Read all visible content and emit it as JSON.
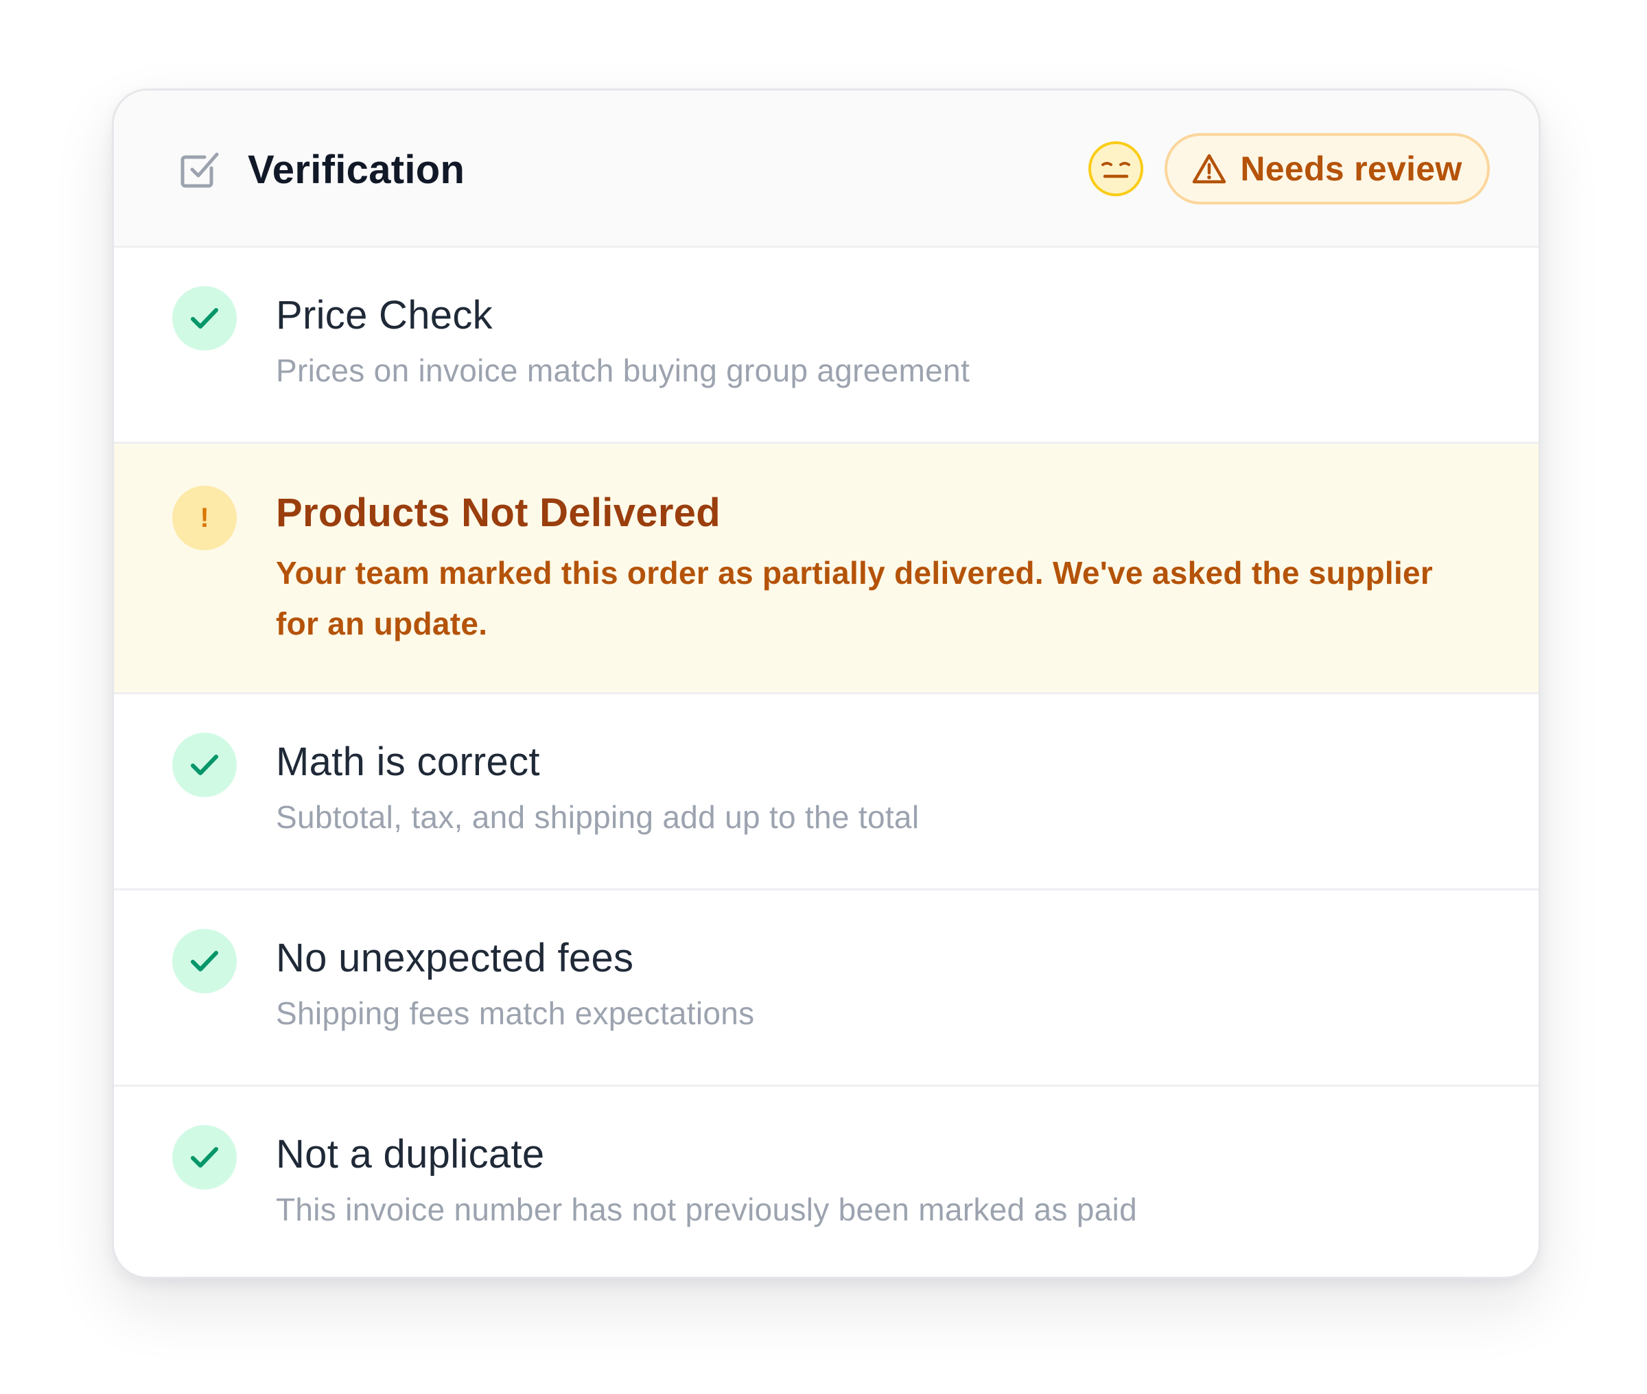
{
  "header": {
    "title": "Verification",
    "icon": "checkbox-icon",
    "status_face_icon": "neutral-face-icon",
    "badge": {
      "label": "Needs review",
      "icon": "warning-triangle-icon"
    }
  },
  "checks": [
    {
      "title": "Price Check",
      "description": "Prices on invoice match buying group agreement",
      "status": "pass",
      "icon": "checkmark-icon"
    },
    {
      "title": "Products Not Delivered",
      "description": "Your team marked this order as partially delivered. We've asked the supplier for an update.",
      "status": "warning",
      "icon": "exclamation-icon",
      "glyph": "!"
    },
    {
      "title": "Math is correct",
      "description": "Subtotal, tax, and shipping add up to the total",
      "status": "pass",
      "icon": "checkmark-icon"
    },
    {
      "title": "No unexpected fees",
      "description": "Shipping fees match expectations",
      "status": "pass",
      "icon": "checkmark-icon"
    },
    {
      "title": "Not a duplicate",
      "description": "This invoice number has not previously been marked as paid",
      "status": "pass",
      "icon": "checkmark-icon"
    }
  ],
  "colors": {
    "pass_bg": "#d1fae5",
    "pass_check": "#059669",
    "warning_bg": "#fefae9",
    "warning_text": "#b45309",
    "warning_title": "#9a3e0d",
    "badge_border": "#fbd69c",
    "badge_bg": "#fff7e6",
    "face_border": "#facc15",
    "face_bg": "#fef3c7"
  }
}
